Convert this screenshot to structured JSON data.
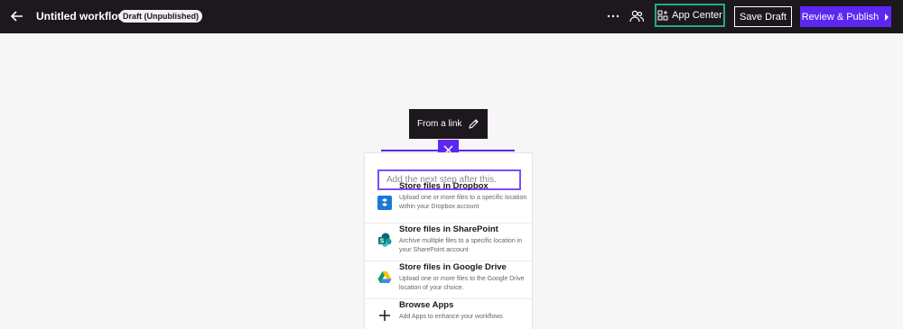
{
  "header": {
    "title": "Untitled workflow",
    "badge": "Draft (Unpublished)",
    "app_center": "App Center",
    "save_draft": "Save Draft",
    "publish": "Review & Publish"
  },
  "step": {
    "label": "From a link"
  },
  "picker": {
    "placeholder": "Add the next step after this.",
    "items": [
      {
        "name": "Store files in Dropbox",
        "desc": "Upload one or more files to a specific location within your Dropbox account",
        "icon": "dropbox-icon"
      },
      {
        "name": "Store files in SharePoint",
        "desc": "Archive multiple files to a specific location in your SharePoint account",
        "icon": "sharepoint-icon"
      },
      {
        "name": "Store files in Google Drive",
        "desc": "Upload one or more files to the Google Drive location of your choice.",
        "icon": "google-drive-icon"
      },
      {
        "name": "Browse Apps",
        "desc": "Add Apps to enhance your workflows",
        "icon": "plus-icon"
      }
    ]
  },
  "colors": {
    "topbar": "#1d171e",
    "accent": "#5d27f2",
    "app_center_border": "#23a98f"
  }
}
